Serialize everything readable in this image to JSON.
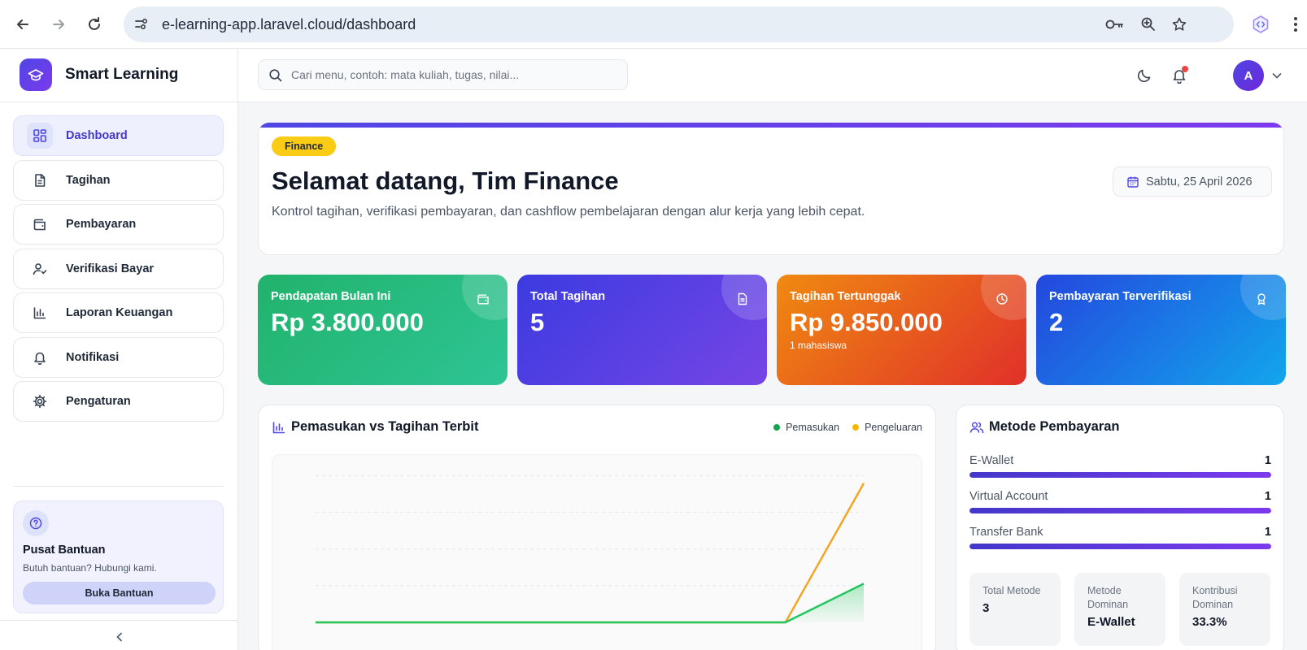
{
  "browser": {
    "url": "e-learning-app.laravel.cloud/dashboard"
  },
  "sidebar": {
    "brand_name": "Smart Learning",
    "items": [
      {
        "label": "Dashboard",
        "icon": "grid-icon",
        "active": true
      },
      {
        "label": "Tagihan",
        "icon": "document-icon",
        "active": false
      },
      {
        "label": "Pembayaran",
        "icon": "wallet-icon",
        "active": false
      },
      {
        "label": "Verifikasi Bayar",
        "icon": "user-check-icon",
        "active": false
      },
      {
        "label": "Laporan Keuangan",
        "icon": "bar-chart-icon",
        "active": false
      },
      {
        "label": "Notifikasi",
        "icon": "bell-icon",
        "active": false
      },
      {
        "label": "Pengaturan",
        "icon": "gear-icon",
        "active": false
      }
    ],
    "help": {
      "title": "Pusat Bantuan",
      "subtitle": "Butuh bantuan? Hubungi kami.",
      "button": "Buka Bantuan"
    }
  },
  "header": {
    "search_placeholder": "Cari menu, contoh: mata kuliah, tugas, nilai...",
    "avatar_initial": "A"
  },
  "welcome": {
    "badge": "Finance",
    "title": "Selamat datang, Tim Finance",
    "subtitle": "Kontrol tagihan, verifikasi pembayaran, dan cashflow pembelajaran dengan alur kerja yang lebih cepat.",
    "date": "Sabtu, 25 April 2026"
  },
  "stats": [
    {
      "label": "Pendapatan Bulan Ini",
      "value": "Rp 3.800.000",
      "note": "",
      "icon": "wallet-icon"
    },
    {
      "label": "Total Tagihan",
      "value": "5",
      "note": "",
      "icon": "document-icon"
    },
    {
      "label": "Tagihan Tertunggak",
      "value": "Rp 9.850.000",
      "note": "1 mahasiswa",
      "icon": "clock-icon"
    },
    {
      "label": "Pembayaran Terverifikasi",
      "value": "2",
      "note": "",
      "icon": "award-icon"
    }
  ],
  "colors": {
    "primary": "#4f46e5",
    "finance_badge": "#facc15",
    "income_series": "#22c55e",
    "expense_series": "#f5a524",
    "stat_green": "#22b573",
    "stat_indigo": "#4338ca",
    "stat_orange": "#ef7d14",
    "stat_blue": "#1d4ed8"
  },
  "chart": {
    "title": "Pemasukan vs Tagihan Terbit",
    "legend": [
      "Pemasukan",
      "Pengeluaran"
    ]
  },
  "chart_data": {
    "type": "line",
    "title": "Pemasukan vs Tagihan Terbit",
    "xlabel": "",
    "ylabel": "",
    "x": [
      0,
      1,
      2,
      3,
      4,
      5,
      6,
      7
    ],
    "grid": true,
    "legend_position": "top-right",
    "series": [
      {
        "name": "Pemasukan",
        "color": "#22c55e",
        "values": [
          0,
          0,
          0,
          0,
          0,
          0,
          0,
          3800000
        ]
      },
      {
        "name": "Pengeluaran",
        "color": "#f5a524",
        "values": [
          0,
          0,
          0,
          0,
          0,
          0,
          0,
          13650000
        ]
      }
    ],
    "ylim": [
      0,
      15000000
    ]
  },
  "methods": {
    "title": "Metode Pembayaran",
    "items": [
      {
        "name": "E-Wallet",
        "count": "1",
        "fraction": 1
      },
      {
        "name": "Virtual Account",
        "count": "1",
        "fraction": 1
      },
      {
        "name": "Transfer Bank",
        "count": "1",
        "fraction": 1
      }
    ],
    "summary": [
      {
        "label": "Total Metode",
        "value": "3"
      },
      {
        "label": "Metode Dominan",
        "value": "E-Wallet"
      },
      {
        "label": "Kontribusi Dominan",
        "value": "33.3%"
      }
    ]
  }
}
